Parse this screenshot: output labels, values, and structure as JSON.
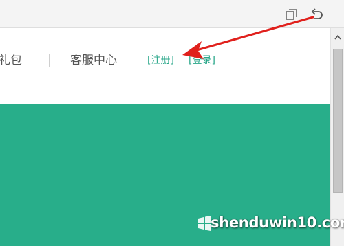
{
  "nav": {
    "gift_pack": "礼包",
    "customer_service": "客服中心",
    "register": "[注册]",
    "login": "[登录]"
  },
  "watermark": {
    "site": "shenduwin10.com"
  },
  "colors": {
    "banner": "#28ae8a",
    "link": "#2aa78a",
    "arrow": "#e0201c"
  },
  "icons": {
    "window": "restore-window-icon",
    "back": "undo-arrow-icon"
  }
}
